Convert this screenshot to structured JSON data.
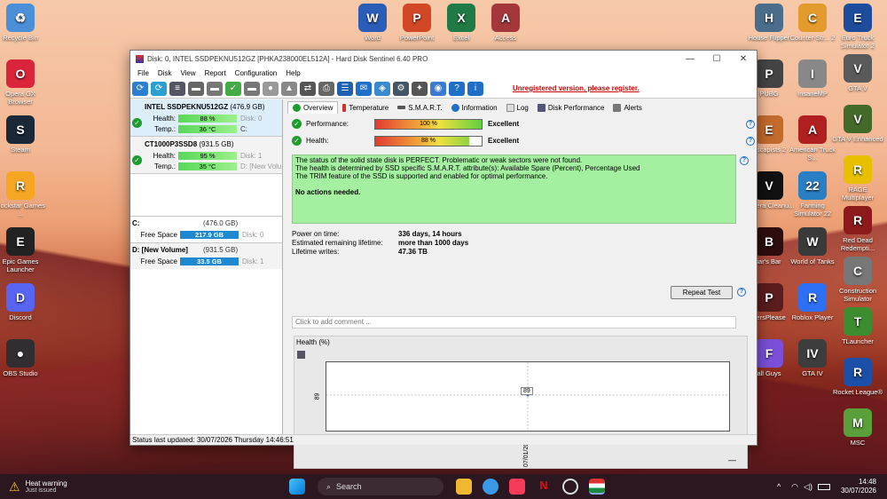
{
  "desktop": {
    "left_icons": [
      {
        "label": "Recycle Bin",
        "color": "#4a8fd8",
        "glyph": "♻"
      },
      {
        "label": "Opera GX Browser",
        "color": "#d9243a",
        "glyph": "O"
      },
      {
        "label": "Steam",
        "color": "#1b2838",
        "glyph": "S"
      },
      {
        "label": "Rockstar Games ...",
        "color": "#f5a623",
        "glyph": "R"
      },
      {
        "label": "Epic Games Launcher",
        "color": "#222222",
        "glyph": "E"
      },
      {
        "label": "Discord",
        "color": "#5865f2",
        "glyph": "D"
      },
      {
        "label": "OBS Studio",
        "color": "#302e31",
        "glyph": "●"
      }
    ],
    "top_icons": [
      {
        "label": "Word",
        "color": "#2b5cb8",
        "glyph": "W"
      },
      {
        "label": "PowerPoint",
        "color": "#d24726",
        "glyph": "P"
      },
      {
        "label": "Excel",
        "color": "#1f7a45",
        "glyph": "X"
      },
      {
        "label": "Access",
        "color": "#a4373a",
        "glyph": "A"
      }
    ],
    "right_icons_col1": [
      {
        "label": "House Flipper",
        "color": "#4a6d8c",
        "glyph": "H"
      },
      {
        "label": "PUBG",
        "color": "#444444",
        "glyph": "P"
      },
      {
        "label": "Escapists 2",
        "color": "#c36a2d",
        "glyph": "E"
      },
      {
        "label": "Viscera Cleanu...",
        "color": "#111111",
        "glyph": "V"
      },
      {
        "label": "iar's Bar",
        "color": "#2d0d0d",
        "glyph": "B"
      },
      {
        "label": "persPlease",
        "color": "#5a1c1c",
        "glyph": "P"
      },
      {
        "label": "all Guys",
        "color": "#7b4fd8",
        "glyph": "F"
      }
    ],
    "right_icons_col2": [
      {
        "label": "Counter-Str... 2",
        "color": "#e39b2b",
        "glyph": "C"
      },
      {
        "label": "InsaneMP",
        "color": "#888888",
        "glyph": "I"
      },
      {
        "label": "American Truck S...",
        "color": "#b02020",
        "glyph": "A"
      },
      {
        "label": "Farming Simulator 22",
        "color": "#2a7fc4",
        "glyph": "22"
      },
      {
        "label": "World of Tanks",
        "color": "#3a3a3a",
        "glyph": "W"
      },
      {
        "label": "Roblox Player",
        "color": "#2d6ff5",
        "glyph": "R"
      },
      {
        "label": "GTA IV",
        "color": "#3d3d3d",
        "glyph": "IV"
      }
    ],
    "right_icons_col3": [
      {
        "label": "Euro Truck Simulator 2",
        "color": "#1d4c9c",
        "glyph": "E"
      },
      {
        "label": "GTA V",
        "color": "#5a5a5a",
        "glyph": "V"
      },
      {
        "label": "GTA V Enhanced",
        "color": "#446a2a",
        "glyph": "V"
      },
      {
        "label": "RAGE Multiplayer",
        "color": "#e8c000",
        "glyph": "R"
      },
      {
        "label": "Red Dead Redempti...",
        "color": "#8c1a1a",
        "glyph": "R"
      },
      {
        "label": "Construction Simulator",
        "color": "#777777",
        "glyph": "C"
      },
      {
        "label": "TLauncher",
        "color": "#3c8d2f",
        "glyph": "T"
      },
      {
        "label": "Rocket League®",
        "color": "#1c4fa8",
        "glyph": "R"
      },
      {
        "label": "MSC",
        "color": "#5aa03a",
        "glyph": "M"
      }
    ],
    "corner_text": "GTA V"
  },
  "window": {
    "title": "Disk: 0, INTEL SSDPEKNU512GZ [PHKA238000EL512A]  -  Hard Disk Sentinel 6.40 PRO",
    "menu": [
      "File",
      "Disk",
      "View",
      "Report",
      "Configuration",
      "Help"
    ],
    "unregistered": "Unregistered version, please register.",
    "status_bar": "Status last updated: 30/07/2026 Thursday 14:46:51"
  },
  "disks": [
    {
      "name": "INTEL SSDPEKNU512GZ",
      "size": "(476.9 GB)",
      "health_label": "Health:",
      "health": "88 %",
      "health_pct": 88,
      "temp_label": "Temp.:",
      "temp": "36 °C",
      "disk_id": "Disk: 0",
      "mount": "C:"
    },
    {
      "name": "CT1000P3SSD8",
      "size": "(931.5 GB)",
      "health_label": "Health:",
      "health": "95 %",
      "health_pct": 95,
      "temp_label": "Temp.:",
      "temp": "35 °C",
      "disk_id": "Disk: 1",
      "mount": "D: [New Volu"
    }
  ],
  "volumes": [
    {
      "name": "C:",
      "size": "(476.0 GB)",
      "free_label": "Free Space",
      "free": "217.9 GB",
      "disk_id": "Disk: 0"
    },
    {
      "name": "D: [New Volume]",
      "size": "(931.5 GB)",
      "free_label": "Free Space",
      "free": "33.5 GB",
      "disk_id": "Disk: 1"
    }
  ],
  "tabs": [
    "Overview",
    "Temperature",
    "S.M.A.R.T.",
    "Information",
    "Log",
    "Disk Performance",
    "Alerts"
  ],
  "overview": {
    "performance_label": "Performance:",
    "performance_bar": "100 %",
    "performance_pct": 100,
    "performance_value": "Excellent",
    "health_label": "Health:",
    "health_bar": "88 %",
    "health_pct": 88,
    "health_value": "Excellent",
    "status_lines": [
      "The status of the solid state disk is PERFECT. Problematic or weak sectors were not found.",
      "The health is determined by SSD specific S.M.A.R.T. attribute(s):  Available Spare (Percent), Percentage Used",
      "The TRIM feature of the SSD is supported and enabled for optimal performance."
    ],
    "status_action": "No actions needed.",
    "power_on_label": "Power on time:",
    "power_on": "336 days, 14 hours",
    "remaining_label": "Estimated remaining lifetime:",
    "remaining": "more than 1000 days",
    "writes_label": "Lifetime writes:",
    "writes": "47.36 TB",
    "repeat_test": "Repeat Test",
    "comment_placeholder": "Click to add comment ...",
    "graph_title": "Health (%)"
  },
  "chart_data": {
    "type": "line",
    "x": [
      "07/01/2026"
    ],
    "values": [
      89
    ],
    "ytick": "89",
    "point_label": "89",
    "xlabel": "",
    "ylabel": ""
  },
  "taskbar": {
    "warning_title": "Heat warning",
    "warning_sub": "Just issued",
    "search": "Search",
    "time": "14:48",
    "date": "30/07/2026"
  }
}
